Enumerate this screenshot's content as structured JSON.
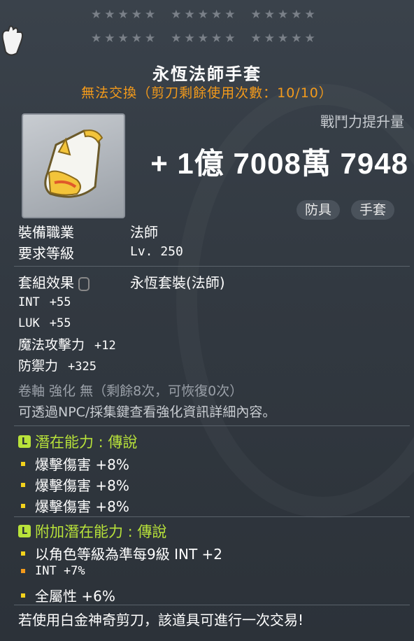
{
  "stars": {
    "rows": 2,
    "groups_per_row": 3,
    "stars_per_group": 5
  },
  "title": "永恆法師手套",
  "trade_notice": "無法交換（剪刀剩餘使用次數：10/10）",
  "combat_power": {
    "label": "戰鬥力提升量",
    "value": "+ 1億 7008萬 7948"
  },
  "tags": [
    "防具",
    "手套"
  ],
  "requirements": [
    {
      "label": "裝備職業",
      "value": "法師"
    },
    {
      "label": "要求等級",
      "value": "Lv. 250"
    }
  ],
  "set_effect": {
    "label": "套組效果",
    "value": "永恆套裝(法師)"
  },
  "stats": [
    {
      "name": "INT",
      "value": "+55"
    },
    {
      "name": "LUK",
      "value": "+55"
    },
    {
      "name": "魔法攻擊力",
      "value": "+12"
    },
    {
      "name": "防禦力",
      "value": "+325"
    }
  ],
  "scroll_info": "卷軸 強化 無（剩餘8次，可恢復0次）",
  "detail_hint": "可透過NPC/採集鍵查看強化資訊詳細內容。",
  "potential": {
    "grade_icon": "L",
    "title": "潛在能力 : 傳說",
    "lines": [
      "爆擊傷害 +8%",
      "爆擊傷害 +8%",
      "爆擊傷害 +8%"
    ]
  },
  "additional_potential": {
    "grade_icon": "L",
    "title": "附加潛在能力 : 傳說",
    "lines": [
      "以角色等級為準每9級 INT +2",
      "INT +7%",
      "全屬性 +6%"
    ]
  },
  "footer": "若使用白金神奇剪刀，該道具可進行一次交易!",
  "colors": {
    "potential": "#b8e23a",
    "trade_notice": "#f39a1b",
    "bullet": "#f2d21c"
  }
}
